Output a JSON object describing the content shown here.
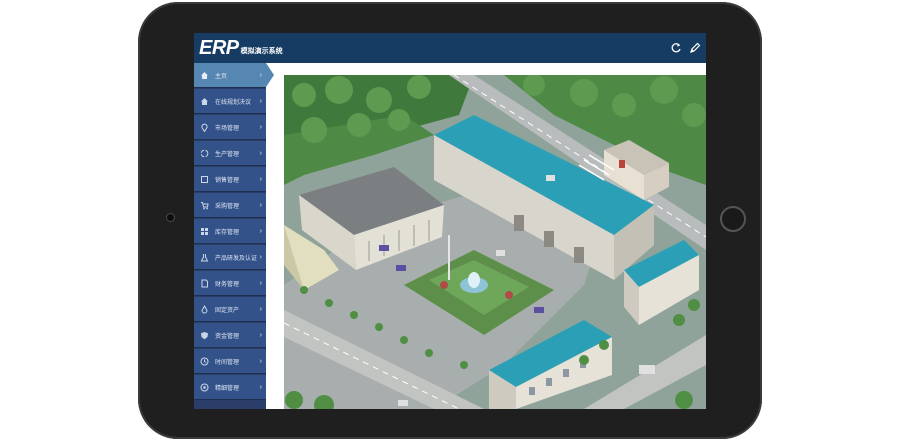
{
  "app": {
    "logo_text": "ERP",
    "logo_subtitle": "模拟演示系统"
  },
  "topbar": {
    "refresh_icon": "refresh-icon",
    "edit_icon": "pencil-icon"
  },
  "sidebar": {
    "items": [
      {
        "label": "主页",
        "icon": "home-icon",
        "active": true
      },
      {
        "label": "在线规划决议",
        "icon": "home-icon"
      },
      {
        "label": "市场管理",
        "icon": "map-pin-icon"
      },
      {
        "label": "生产管理",
        "icon": "cycle-icon"
      },
      {
        "label": "销售管理",
        "icon": "box-icon"
      },
      {
        "label": "采购管理",
        "icon": "cart-icon"
      },
      {
        "label": "库存管理",
        "icon": "grid-icon"
      },
      {
        "label": "产品研发及认证",
        "icon": "flask-icon"
      },
      {
        "label": "财务管理",
        "icon": "doc-icon"
      },
      {
        "label": "固定资产",
        "icon": "drop-icon"
      },
      {
        "label": "资金管理",
        "icon": "shield-icon"
      },
      {
        "label": "时间管理",
        "icon": "clock-icon"
      },
      {
        "label": "精细管理",
        "icon": "circle-icon"
      }
    ]
  },
  "colors": {
    "topbar": "#173c64",
    "sidebar": "#34528a",
    "active": "#5687b3"
  },
  "main": {
    "image": "factory-aerial-view"
  }
}
